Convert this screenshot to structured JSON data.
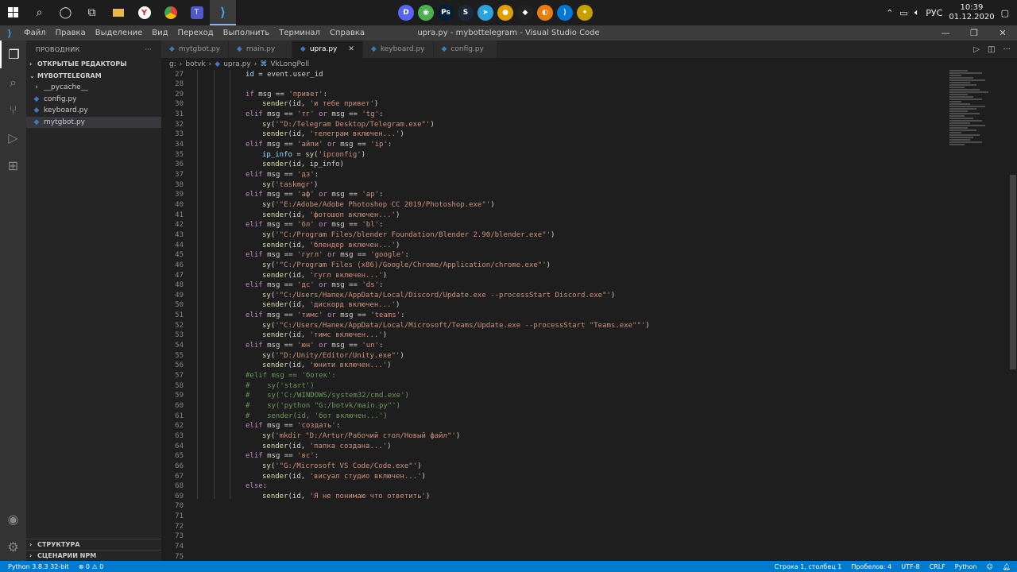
{
  "taskbar": {
    "clock_time": "10:39",
    "clock_date": "01.12.2020",
    "language": "РУС",
    "left_icons": [
      "windows-icon",
      "search-icon",
      "cortana-icon",
      "task-view-icon",
      "explorer-icon",
      "yandex-icon",
      "chrome-icon",
      "teams-icon",
      "vscode-icon"
    ],
    "center_apps": [
      {
        "name": "discord",
        "color": "#5865f2",
        "glyph": "D"
      },
      {
        "name": "chrome",
        "color": "#4caf50",
        "glyph": "◉"
      },
      {
        "name": "photoshop",
        "color": "#001e36",
        "glyph": "Ps"
      },
      {
        "name": "steam",
        "color": "#1b2838",
        "glyph": "S"
      },
      {
        "name": "telegram",
        "color": "#2aa3df",
        "glyph": "➤"
      },
      {
        "name": "app-rainbow",
        "color": "#e0a000",
        "glyph": "●"
      },
      {
        "name": "unity",
        "color": "#222222",
        "glyph": "◆"
      },
      {
        "name": "blender",
        "color": "#e87d0d",
        "glyph": "◐"
      },
      {
        "name": "vscode",
        "color": "#0078d4",
        "glyph": "⟩"
      },
      {
        "name": "csgo",
        "color": "#c6a000",
        "glyph": "✦"
      }
    ]
  },
  "menubar": {
    "items": [
      "Файл",
      "Правка",
      "Выделение",
      "Вид",
      "Переход",
      "Выполнить",
      "Терминал",
      "Справка"
    ],
    "window_title": "upra.py - mybottelegram - Visual Studio Code"
  },
  "sidebar": {
    "title": "ПРОВОДНИК",
    "more": "···",
    "open_editors": "ОТКРЫТЫЕ РЕДАКТОРЫ",
    "project": "MYBOTTELEGRAM",
    "items": [
      {
        "label": "__pycache__",
        "type": "folder"
      },
      {
        "label": "config.py",
        "type": "py"
      },
      {
        "label": "keyboard.py",
        "type": "py"
      },
      {
        "label": "mytgbot.py",
        "type": "py"
      }
    ],
    "structure": "СТРУКТУРА",
    "npm": "СЦЕНАРИИ NPM"
  },
  "tabs": [
    {
      "label": "mytgbot.py",
      "active": false
    },
    {
      "label": "main.py",
      "active": false
    },
    {
      "label": "upra.py",
      "active": true
    },
    {
      "label": "keyboard.py",
      "active": false
    },
    {
      "label": "config.py",
      "active": false
    }
  ],
  "breadcrumb": [
    "g:",
    "botvk",
    "upra.py",
    "VkLongPoll"
  ],
  "code_lines": [
    {
      "n": "27",
      "indent": 2,
      "tokens": [
        [
          "var",
          "id"
        ],
        [
          "op",
          " = event.user_id"
        ]
      ]
    },
    {
      "n": "28",
      "indent": 0,
      "tokens": []
    },
    {
      "n": "29",
      "indent": 2,
      "tokens": [
        [
          "kw",
          "if"
        ],
        [
          "op",
          " msg == "
        ],
        [
          "str",
          "'привет'"
        ],
        [
          "op",
          ":"
        ]
      ]
    },
    {
      "n": "30",
      "indent": 3,
      "tokens": [
        [
          "fn",
          "sender"
        ],
        [
          "op",
          "(id, "
        ],
        [
          "str",
          "'и тебе привет'"
        ],
        [
          "op",
          ")"
        ]
      ]
    },
    {
      "n": "31",
      "indent": 2,
      "tokens": [
        [
          "kw",
          "elif"
        ],
        [
          "op",
          " msg == "
        ],
        [
          "str",
          "'тг'"
        ],
        [
          "kw",
          " or"
        ],
        [
          "op",
          " msg == "
        ],
        [
          "str",
          "'tg'"
        ],
        [
          "op",
          ":"
        ]
      ]
    },
    {
      "n": "32",
      "indent": 3,
      "tokens": [
        [
          "fn",
          "sy"
        ],
        [
          "op",
          "("
        ],
        [
          "str",
          "'\"D:/Telegram Desktop/Telegram.exe\"'"
        ],
        [
          "op",
          ")"
        ]
      ]
    },
    {
      "n": "33",
      "indent": 3,
      "tokens": [
        [
          "fn",
          "sender"
        ],
        [
          "op",
          "(id, "
        ],
        [
          "str",
          "'телеграм включен...'"
        ],
        [
          "op",
          ")"
        ]
      ]
    },
    {
      "n": "34",
      "indent": 2,
      "tokens": [
        [
          "kw",
          "elif"
        ],
        [
          "op",
          " msg == "
        ],
        [
          "str",
          "'айпи'"
        ],
        [
          "kw",
          " or"
        ],
        [
          "op",
          " msg == "
        ],
        [
          "str",
          "'ip'"
        ],
        [
          "op",
          ":"
        ]
      ]
    },
    {
      "n": "35",
      "indent": 3,
      "tokens": [
        [
          "var",
          "ip_info"
        ],
        [
          "op",
          " = "
        ],
        [
          "fn",
          "sy"
        ],
        [
          "op",
          "("
        ],
        [
          "str",
          "'ipconfig'"
        ],
        [
          "op",
          ")"
        ]
      ]
    },
    {
      "n": "36",
      "indent": 3,
      "tokens": [
        [
          "fn",
          "sender"
        ],
        [
          "op",
          "(id, ip_info)"
        ]
      ]
    },
    {
      "n": "37",
      "indent": 2,
      "tokens": [
        [
          "kw",
          "elif"
        ],
        [
          "op",
          " msg == "
        ],
        [
          "str",
          "'дз'"
        ],
        [
          "op",
          ":"
        ]
      ]
    },
    {
      "n": "38",
      "indent": 3,
      "tokens": [
        [
          "fn",
          "sy"
        ],
        [
          "op",
          "("
        ],
        [
          "str",
          "'taskmgr'"
        ],
        [
          "op",
          ")"
        ]
      ]
    },
    {
      "n": "39",
      "indent": 2,
      "tokens": [
        [
          "kw",
          "elif"
        ],
        [
          "op",
          " msg == "
        ],
        [
          "str",
          "'аф'"
        ],
        [
          "kw",
          " or"
        ],
        [
          "op",
          " msg == "
        ],
        [
          "str",
          "'ap'"
        ],
        [
          "op",
          ":"
        ]
      ]
    },
    {
      "n": "40",
      "indent": 3,
      "tokens": [
        [
          "fn",
          "sy"
        ],
        [
          "op",
          "("
        ],
        [
          "str",
          "'\"E:/Adobe/Adobe Photoshop CC 2019/Photoshop.exe\"'"
        ],
        [
          "op",
          ")"
        ]
      ]
    },
    {
      "n": "41",
      "indent": 3,
      "tokens": [
        [
          "fn",
          "sender"
        ],
        [
          "op",
          "(id, "
        ],
        [
          "str",
          "'фотошоп включен...'"
        ],
        [
          "op",
          ")"
        ]
      ]
    },
    {
      "n": "42",
      "indent": 2,
      "tokens": [
        [
          "kw",
          "elif"
        ],
        [
          "op",
          " msg == "
        ],
        [
          "str",
          "'бл'"
        ],
        [
          "kw",
          " or"
        ],
        [
          "op",
          " msg == "
        ],
        [
          "str",
          "'bl'"
        ],
        [
          "op",
          ":"
        ]
      ]
    },
    {
      "n": "43",
      "indent": 3,
      "tokens": [
        [
          "fn",
          "sy"
        ],
        [
          "op",
          "("
        ],
        [
          "str",
          "'\"C:/Program Files/blender Foundation/Blender 2.90/blender.exe\"'"
        ],
        [
          "op",
          ")"
        ]
      ]
    },
    {
      "n": "44",
      "indent": 3,
      "tokens": [
        [
          "fn",
          "sender"
        ],
        [
          "op",
          "(id, "
        ],
        [
          "str",
          "'блендер включен...'"
        ],
        [
          "op",
          ")"
        ]
      ]
    },
    {
      "n": "45",
      "indent": 2,
      "tokens": [
        [
          "kw",
          "elif"
        ],
        [
          "op",
          " msg == "
        ],
        [
          "str",
          "'гугл'"
        ],
        [
          "kw",
          " or"
        ],
        [
          "op",
          " msg == "
        ],
        [
          "str",
          "'google'"
        ],
        [
          "op",
          ":"
        ]
      ]
    },
    {
      "n": "46",
      "indent": 3,
      "tokens": [
        [
          "fn",
          "sy"
        ],
        [
          "op",
          "("
        ],
        [
          "str",
          "'\"C:/Program Files (x86)/Google/Chrome/Application/chrome.exe\"'"
        ],
        [
          "op",
          ")"
        ]
      ]
    },
    {
      "n": "47",
      "indent": 3,
      "tokens": [
        [
          "fn",
          "sender"
        ],
        [
          "op",
          "(id, "
        ],
        [
          "str",
          "'гугл включен...'"
        ],
        [
          "op",
          ")"
        ]
      ]
    },
    {
      "n": "48",
      "indent": 2,
      "tokens": [
        [
          "kw",
          "elif"
        ],
        [
          "op",
          " msg == "
        ],
        [
          "str",
          "'дс'"
        ],
        [
          "kw",
          " or"
        ],
        [
          "op",
          " msg == "
        ],
        [
          "str",
          "'ds'"
        ],
        [
          "op",
          ":"
        ]
      ]
    },
    {
      "n": "49",
      "indent": 3,
      "tokens": [
        [
          "fn",
          "sy"
        ],
        [
          "op",
          "("
        ],
        [
          "str",
          "'\"C:/Users/Напек/AppData/Local/Discord/Update.exe --processStart Discord.exe\"'"
        ],
        [
          "op",
          ")"
        ]
      ]
    },
    {
      "n": "50",
      "indent": 3,
      "tokens": [
        [
          "fn",
          "sender"
        ],
        [
          "op",
          "(id, "
        ],
        [
          "str",
          "'дискорд включен...'"
        ],
        [
          "op",
          ")"
        ]
      ]
    },
    {
      "n": "51",
      "indent": 2,
      "tokens": [
        [
          "kw",
          "elif"
        ],
        [
          "op",
          " msg == "
        ],
        [
          "str",
          "'тимс'"
        ],
        [
          "kw",
          " or"
        ],
        [
          "op",
          " msg == "
        ],
        [
          "str",
          "'teams'"
        ],
        [
          "op",
          ":"
        ]
      ]
    },
    {
      "n": "52",
      "indent": 3,
      "tokens": [
        [
          "fn",
          "sy"
        ],
        [
          "op",
          "("
        ],
        [
          "str",
          "'\"C:/Users/Напек/AppData/Local/Microsoft/Teams/Update.exe --processStart \"Teams.exe\"\"'"
        ],
        [
          "op",
          ")"
        ]
      ]
    },
    {
      "n": "53",
      "indent": 3,
      "tokens": [
        [
          "fn",
          "sender"
        ],
        [
          "op",
          "(id, "
        ],
        [
          "str",
          "'тимс включен...'"
        ],
        [
          "op",
          ")"
        ]
      ]
    },
    {
      "n": "54",
      "indent": 2,
      "tokens": [
        [
          "kw",
          "elif"
        ],
        [
          "op",
          " msg == "
        ],
        [
          "str",
          "'юн'"
        ],
        [
          "kw",
          " or"
        ],
        [
          "op",
          " msg == "
        ],
        [
          "str",
          "'un'"
        ],
        [
          "op",
          ":"
        ]
      ]
    },
    {
      "n": "55",
      "indent": 3,
      "tokens": [
        [
          "fn",
          "sy"
        ],
        [
          "op",
          "("
        ],
        [
          "str",
          "'\"D:/Unity/Editor/Unity.exe\"'"
        ],
        [
          "op",
          ")"
        ]
      ]
    },
    {
      "n": "56",
      "indent": 3,
      "tokens": [
        [
          "fn",
          "sender"
        ],
        [
          "op",
          "(id, "
        ],
        [
          "str",
          "'юнити включен...'"
        ],
        [
          "op",
          ")"
        ]
      ]
    },
    {
      "n": "57",
      "indent": 2,
      "tokens": [
        [
          "cm",
          "#elif msg == 'ботек':"
        ]
      ]
    },
    {
      "n": "58",
      "indent": 2,
      "tokens": [
        [
          "cm",
          "#    sy('start')"
        ]
      ]
    },
    {
      "n": "59",
      "indent": 2,
      "tokens": [
        [
          "cm",
          "#    sy('C:/WINDOWS/system32/cmd.exe')"
        ]
      ]
    },
    {
      "n": "60",
      "indent": 2,
      "tokens": [
        [
          "cm",
          "#    sy('python \"G:/botvk/main.py\"')"
        ]
      ]
    },
    {
      "n": "61",
      "indent": 2,
      "tokens": [
        [
          "cm",
          "#    sender(id, 'бот включен...')"
        ]
      ]
    },
    {
      "n": "62",
      "indent": 2,
      "tokens": [
        [
          "kw",
          "elif"
        ],
        [
          "op",
          " msg == "
        ],
        [
          "str",
          "'создать'"
        ],
        [
          "op",
          ":"
        ]
      ]
    },
    {
      "n": "63",
      "indent": 3,
      "tokens": [
        [
          "fn",
          "sy"
        ],
        [
          "op",
          "("
        ],
        [
          "str",
          "'mkdir \"D:/Artur/Рабочий стол/Новый файл\"'"
        ],
        [
          "op",
          ")"
        ]
      ]
    },
    {
      "n": "64",
      "indent": 3,
      "tokens": [
        [
          "fn",
          "sender"
        ],
        [
          "op",
          "(id, "
        ],
        [
          "str",
          "'папка создана...'"
        ],
        [
          "op",
          ")"
        ]
      ]
    },
    {
      "n": "65",
      "indent": 2,
      "tokens": [
        [
          "kw",
          "elif"
        ],
        [
          "op",
          " msg == "
        ],
        [
          "str",
          "'вс'"
        ],
        [
          "op",
          ":"
        ]
      ]
    },
    {
      "n": "66",
      "indent": 3,
      "tokens": [
        [
          "fn",
          "sy"
        ],
        [
          "op",
          "("
        ],
        [
          "str",
          "'\"G:/Microsoft VS Code/Code.exe\"'"
        ],
        [
          "op",
          ")"
        ]
      ]
    },
    {
      "n": "67",
      "indent": 3,
      "tokens": [
        [
          "fn",
          "sender"
        ],
        [
          "op",
          "(id, "
        ],
        [
          "str",
          "'висуал студио включен...'"
        ],
        [
          "op",
          ")"
        ]
      ]
    },
    {
      "n": "68",
      "indent": 2,
      "tokens": [
        [
          "kw",
          "else"
        ],
        [
          "op",
          ":"
        ]
      ]
    },
    {
      "n": "69",
      "indent": 3,
      "tokens": [
        [
          "fn",
          "sender"
        ],
        [
          "op",
          "(id, "
        ],
        [
          "str",
          "'Я не понимаю что ответить'"
        ],
        [
          "op",
          ")"
        ]
      ]
    },
    {
      "n": "70",
      "indent": 0,
      "tokens": []
    },
    {
      "n": "71",
      "indent": 0,
      "tokens": []
    },
    {
      "n": "72",
      "indent": 0,
      "tokens": []
    },
    {
      "n": "73",
      "indent": 0,
      "tokens": []
    },
    {
      "n": "74",
      "indent": 0,
      "tokens": []
    },
    {
      "n": "75",
      "indent": 0,
      "tokens": []
    }
  ],
  "statusbar": {
    "python": "Python 3.8.3 32-bit",
    "problems": "⊗ 0 ⚠ 0",
    "position": "Строка 1, столбец 1",
    "spaces": "Пробелов: 4",
    "encoding": "UTF-8",
    "eol": "CRLF",
    "language": "Python"
  },
  "colors": {
    "statusbar": "#007acc",
    "keyword": "#c586c0",
    "string": "#ce9178",
    "function": "#dcdcaa",
    "comment": "#6a9955"
  }
}
